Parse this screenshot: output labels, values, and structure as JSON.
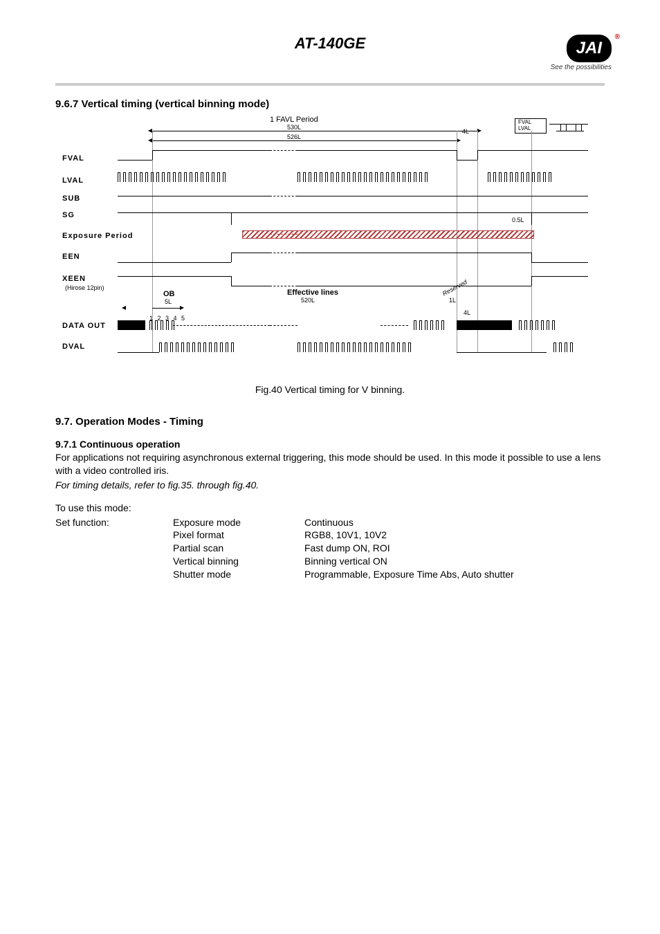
{
  "header": {
    "doc_title": "AT-140GE",
    "logo_text": "JAI",
    "logo_reg": "®",
    "tagline": "See the possibilities"
  },
  "section_967": {
    "heading": "9.6.7   Vertical timing (vertical binning mode)",
    "fig_caption": "Fig.40    Vertical timing for V binning."
  },
  "diagram": {
    "favl_period": "1 FAVL Period",
    "favl_530": "530L",
    "favl_526": "526L",
    "favl_4l": "4L",
    "callout_fval": "FVAL",
    "callout_lval": "LVAL",
    "sig_fval": "FVAL",
    "sig_lval": "LVAL",
    "sig_sub": "SUB",
    "sig_sg": "SG",
    "sg_05l": "0.5L",
    "sig_exposure": "Exposure Period",
    "sig_een": "EEN",
    "sig_xeen": "XEEN",
    "xeen_note": "(Hirose 12pin)",
    "ob": "OB",
    "ob_5l": "5L",
    "eff_lines": "Effective lines",
    "eff_520": "520L",
    "reserved": "Reserved",
    "reserved_1l": "1L",
    "reserved_4l": "4L",
    "dataout_12345": "1 2 3 4 5",
    "sig_dataout": "DATA  OUT",
    "sig_dval": "DVAL"
  },
  "section_97": {
    "heading": "9.7.   Operation Modes - Timing"
  },
  "section_971": {
    "heading": "9.7.1   Continuous operation",
    "para1": "For applications not requiring asynchronous external triggering, this mode should be used. In this mode it possible to use a lens with a video controlled iris.",
    "para2": "For timing details, refer to fig.35. through fig.40.",
    "to_use": "To use this mode:",
    "set_function": "Set function:",
    "rows": [
      {
        "k": "Exposure mode",
        "v": "Continuous"
      },
      {
        "k": "Pixel format",
        "v": "RGB8, 10V1, 10V2"
      },
      {
        "k": "Partial scan",
        "v": "Fast dump ON, ROI"
      },
      {
        "k": "Vertical binning",
        "v": "Binning vertical ON"
      },
      {
        "k": "Shutter mode",
        "v": "Programmable, Exposure Time Abs, Auto shutter"
      }
    ]
  }
}
